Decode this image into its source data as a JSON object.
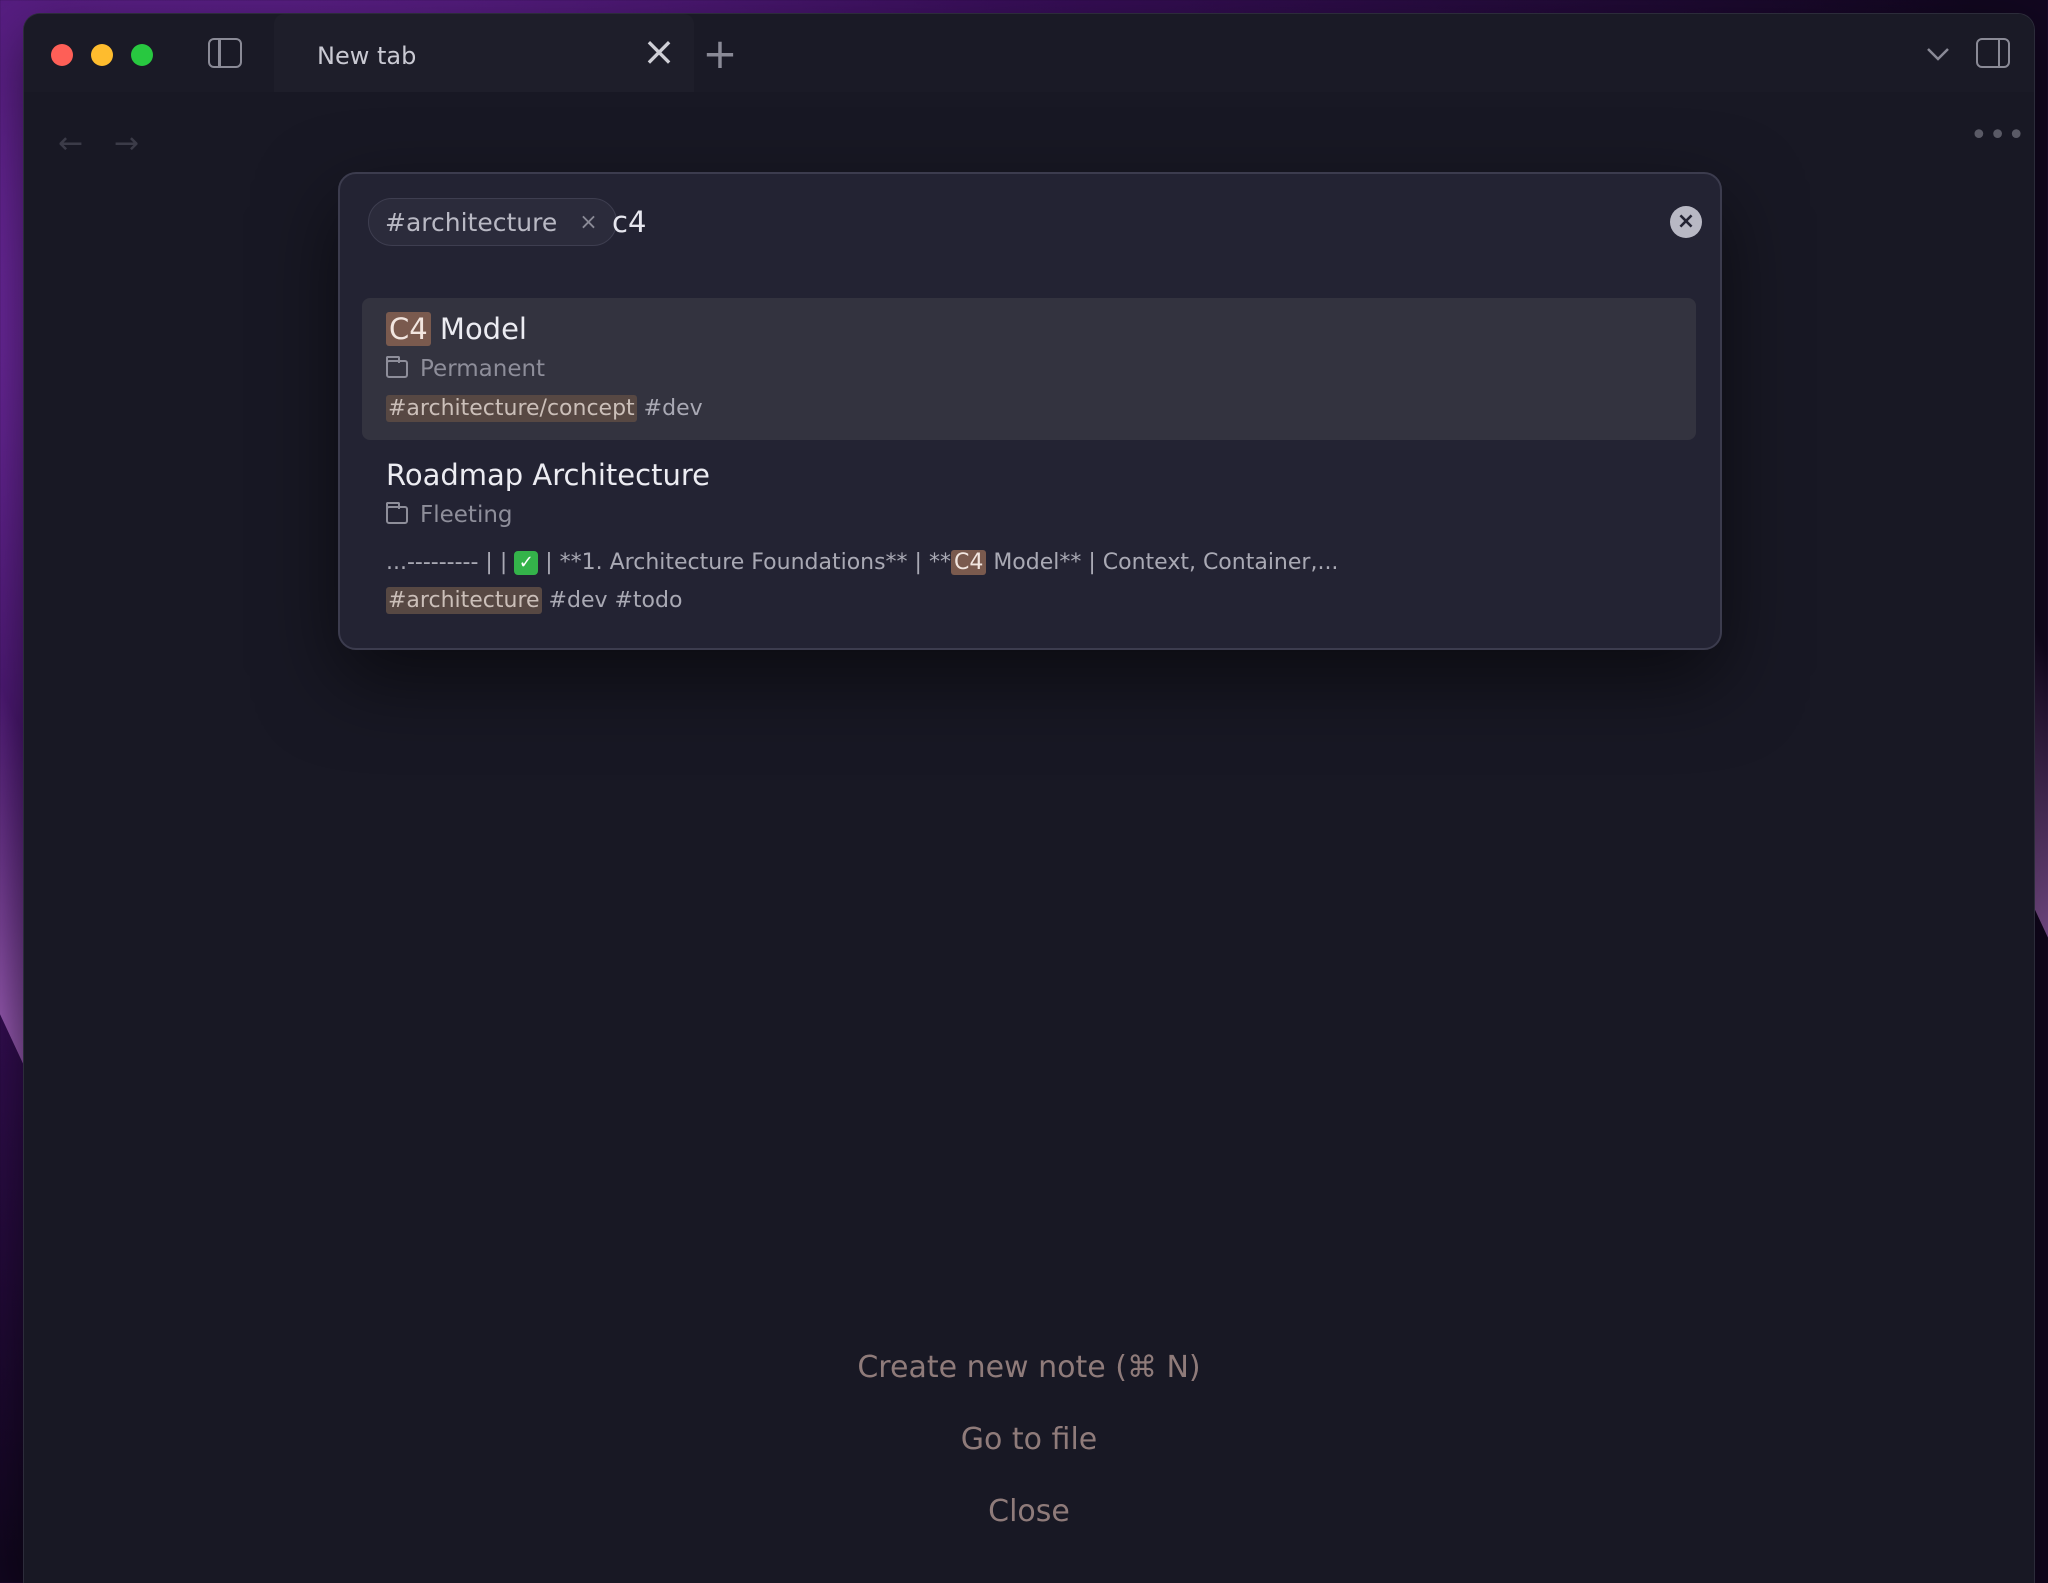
{
  "window": {
    "tab_title": "New tab",
    "new_tab_label": "+",
    "tab_close_label": "×"
  },
  "nav": {
    "back": "←",
    "forward": "→",
    "more": "•••"
  },
  "search": {
    "filter_chip": "#architecture",
    "chip_remove": "×",
    "query": "c4",
    "clear": "×"
  },
  "results": [
    {
      "title_highlight": "C4",
      "title_rest": " Model",
      "folder": "Permanent",
      "tag_highlight": "#architecture/concept",
      "tags_rest": " #dev"
    },
    {
      "title": "Roadmap Architecture",
      "folder": "Fleeting",
      "snippet_pre": "...--------- | | ",
      "snippet_check": "✓",
      "snippet_mid": " | **1. Architecture Foundations** | **",
      "snippet_highlight": "C4",
      "snippet_post": " Model** | Context, Container,...",
      "tag_highlight": "#architecture",
      "tags_rest": " #dev #todo"
    }
  ],
  "actions": {
    "create": "Create new note (⌘ N)",
    "goto": "Go to file",
    "close": "Close"
  },
  "colors": {
    "highlight": "#7a5a4e",
    "accent_red": "#fe5f57",
    "accent_yellow": "#febc2e",
    "accent_green": "#28c840"
  }
}
